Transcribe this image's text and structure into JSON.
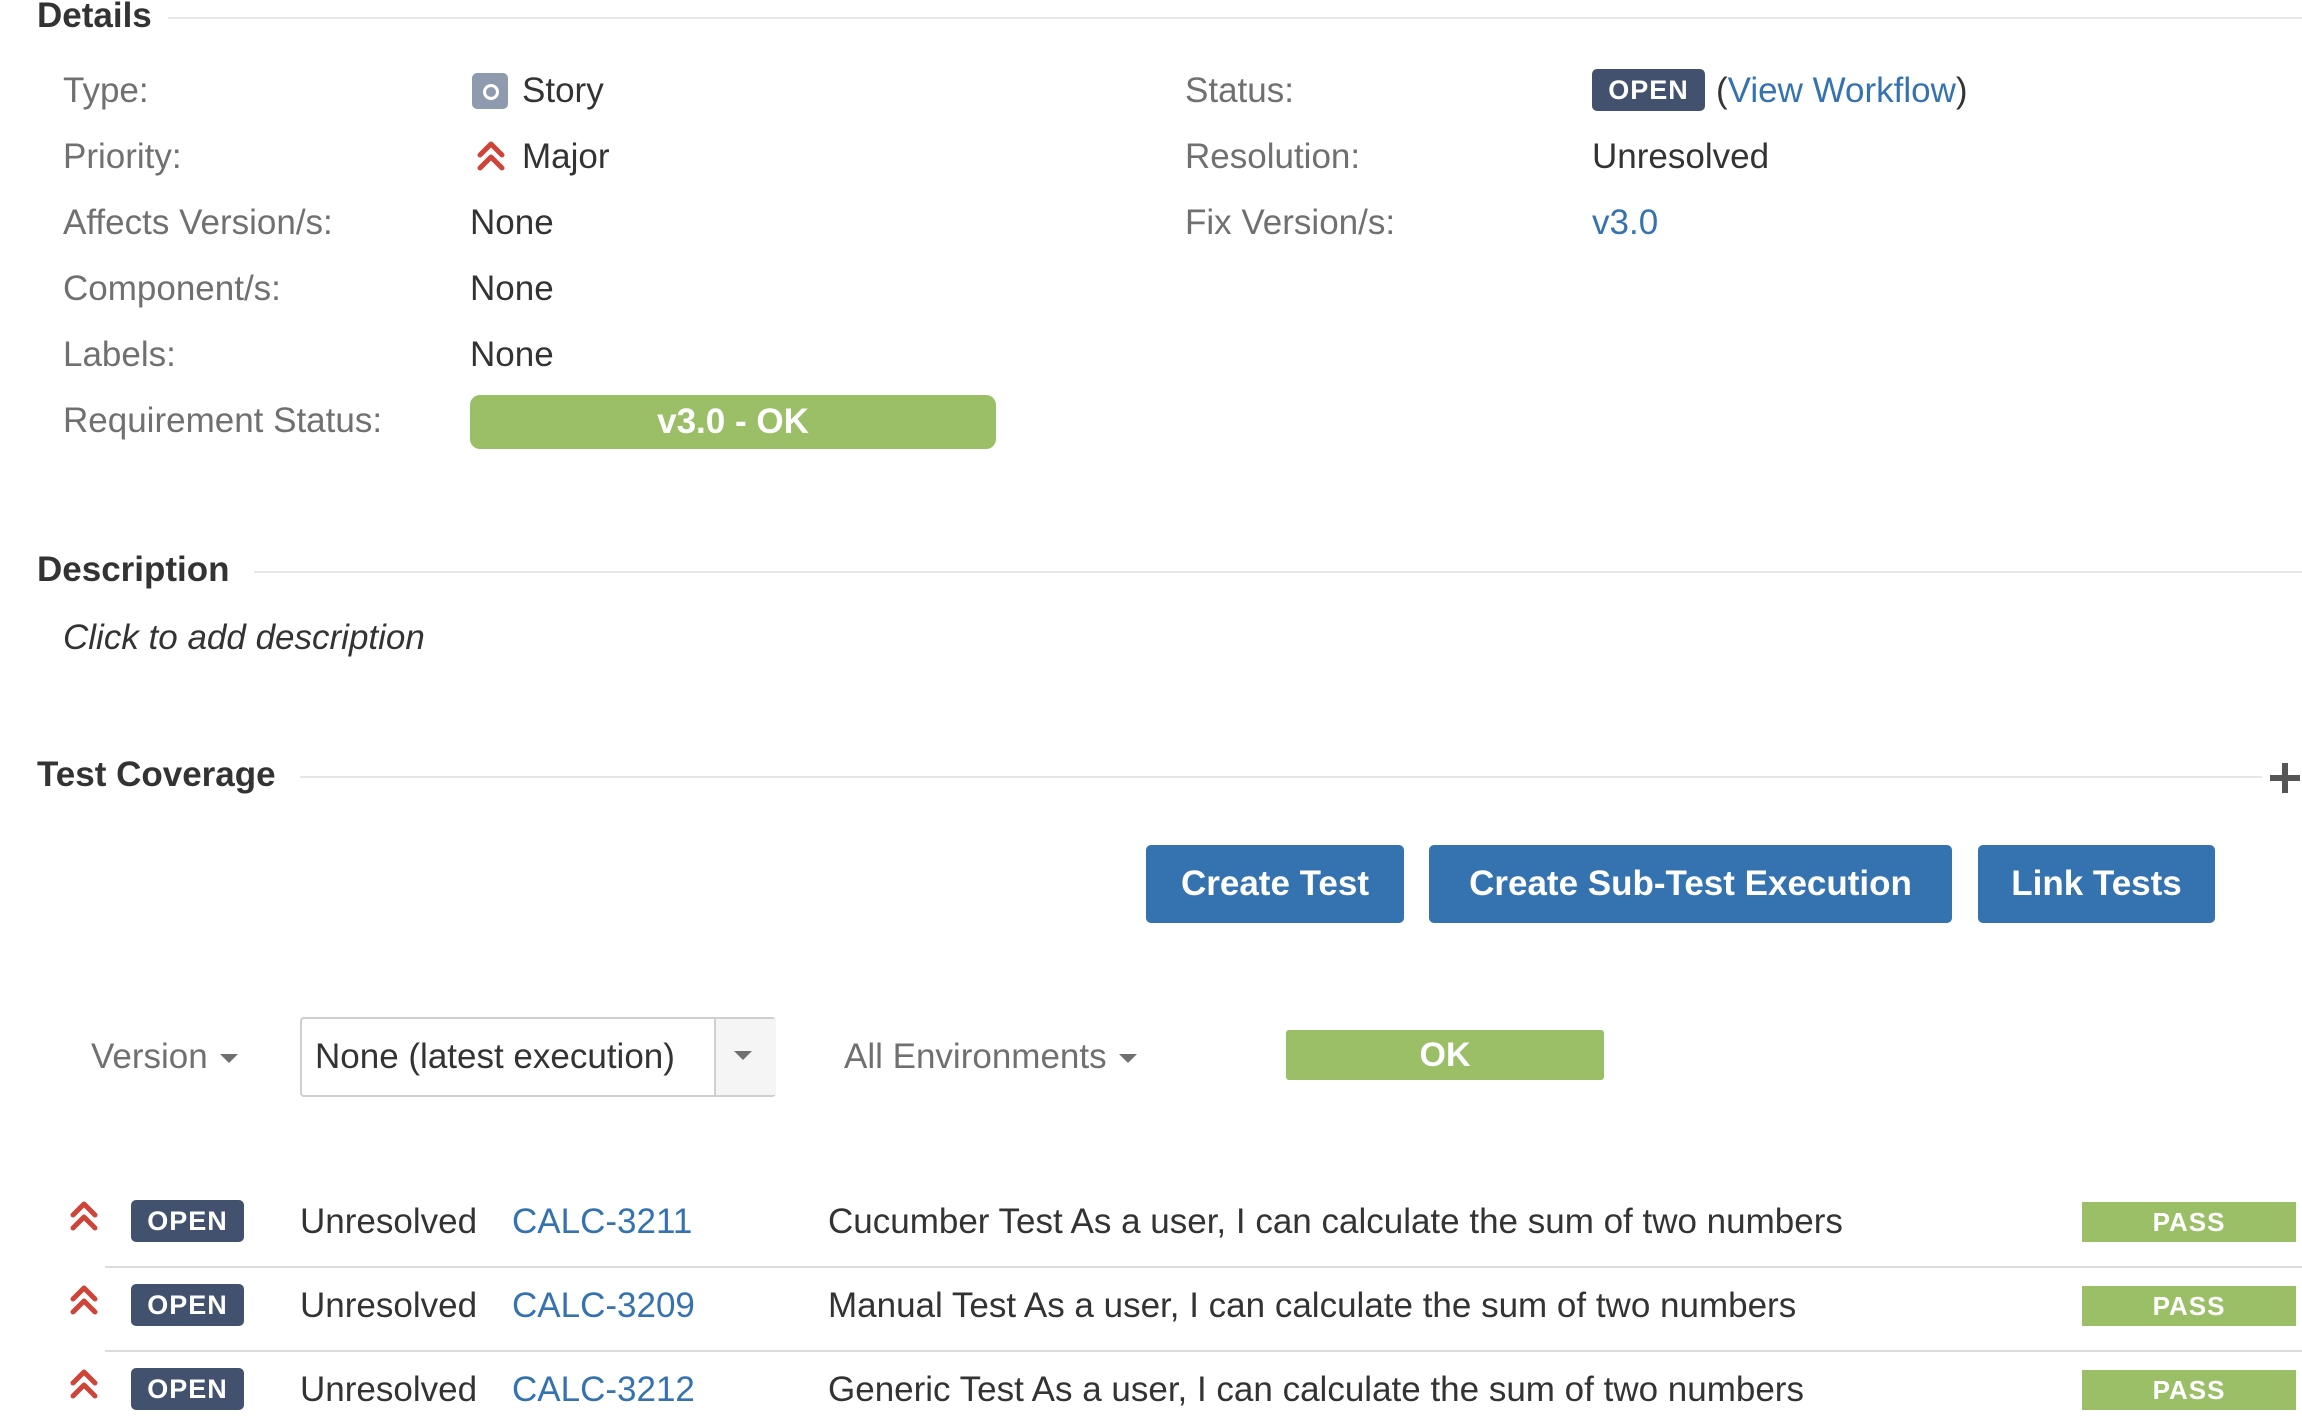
{
  "details": {
    "title": "Details",
    "left_fields": [
      {
        "label": "Type:",
        "value": "Story",
        "icon": "story-icon"
      },
      {
        "label": "Priority:",
        "value": "Major",
        "icon": "priority-major-icon"
      },
      {
        "label": "Affects Version/s:",
        "value": "None"
      },
      {
        "label": "Component/s:",
        "value": "None"
      },
      {
        "label": "Labels:",
        "value": "None"
      },
      {
        "label": "Requirement Status:",
        "value": "v3.0 - OK"
      }
    ],
    "right_fields": [
      {
        "label": "Status:",
        "value": "OPEN",
        "link": "View Workflow",
        "paren_open": "(",
        "paren_close": ")"
      },
      {
        "label": "Resolution:",
        "value": "Unresolved"
      },
      {
        "label": "Fix Version/s:",
        "value": "v3.0"
      }
    ]
  },
  "description": {
    "title": "Description",
    "placeholder": "Click to add description"
  },
  "test_coverage": {
    "title": "Test Coverage",
    "add_icon": "plus-icon",
    "buttons": {
      "create_test": "Create Test",
      "create_sub_test_execution": "Create Sub-Test Execution",
      "link_tests": "Link Tests"
    },
    "filters": {
      "version_label": "Version",
      "version_select_value": "None (latest execution)",
      "environments_label": "All Environments",
      "overall_status": "OK"
    },
    "tests": [
      {
        "status": "OPEN",
        "resolution": "Unresolved",
        "key": "CALC-3211",
        "summary": "Cucumber Test As a user, I can calculate the sum of two numbers",
        "result": "PASS"
      },
      {
        "status": "OPEN",
        "resolution": "Unresolved",
        "key": "CALC-3209",
        "summary": "Manual Test As a user, I can calculate the sum of two numbers",
        "result": "PASS"
      },
      {
        "status": "OPEN",
        "resolution": "Unresolved",
        "key": "CALC-3212",
        "summary": "Generic Test As a user, I can calculate the sum of two numbers",
        "result": "PASS"
      }
    ]
  },
  "colors": {
    "link": "#3572b0",
    "open_lozenge": "#42526e",
    "ok_green": "#9bbf67",
    "priority_red": "#d04437",
    "button_blue": "#3572b0"
  }
}
